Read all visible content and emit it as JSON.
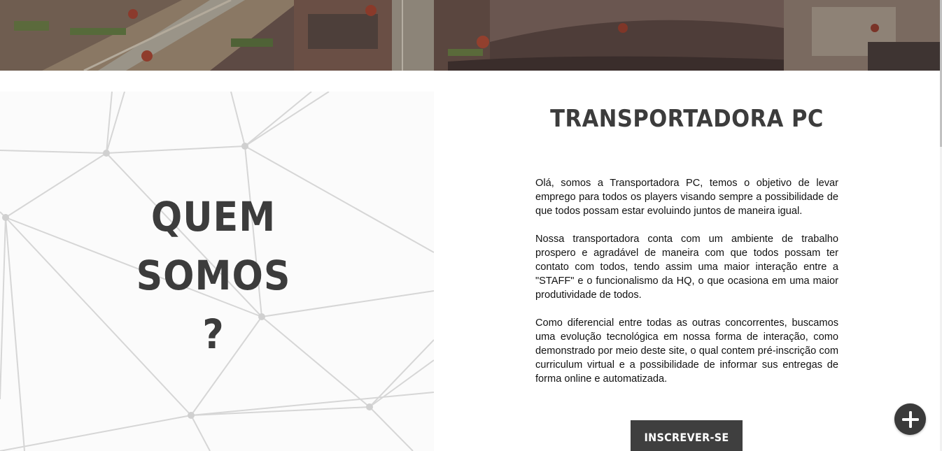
{
  "hero": {
    "image": "aerial-city-banner"
  },
  "about": {
    "heading_lines": [
      "QUEM",
      "SOMOS",
      "?"
    ],
    "title": "TRANSPORTADORA PC",
    "paragraphs": [
      "Olá, somos a Transportadora PC, temos o objetivo de levar emprego para todos os players visando sempre a possibilidade de que todos possam estar evoluindo juntos de maneira igual.",
      "Nossa transportadora conta com um ambiente de trabalho prospero e agradável de maneira com que todos possam ter contato com todos, tendo assim uma maior interação entre a \"STAFF\" e o funcionalismo da HQ, o que ocasiona em uma maior produtividade de todos.",
      "Como diferencial entre todas as outras concorrentes, buscamos uma evolução tecnológica em nossa forma de interação, como demonstrado por meio deste site, o qual contem pré-inscrição com curriculum virtual e a possibilidade de informar sus entregas de forma online e automatizada."
    ],
    "button_label": "INSCREVER-SE"
  },
  "fab": {
    "icon": "plus-icon"
  },
  "colors": {
    "text_dark": "#3c3c3c",
    "button_bg": "#3f3f3f",
    "fab_bg": "#3a3a3a"
  }
}
